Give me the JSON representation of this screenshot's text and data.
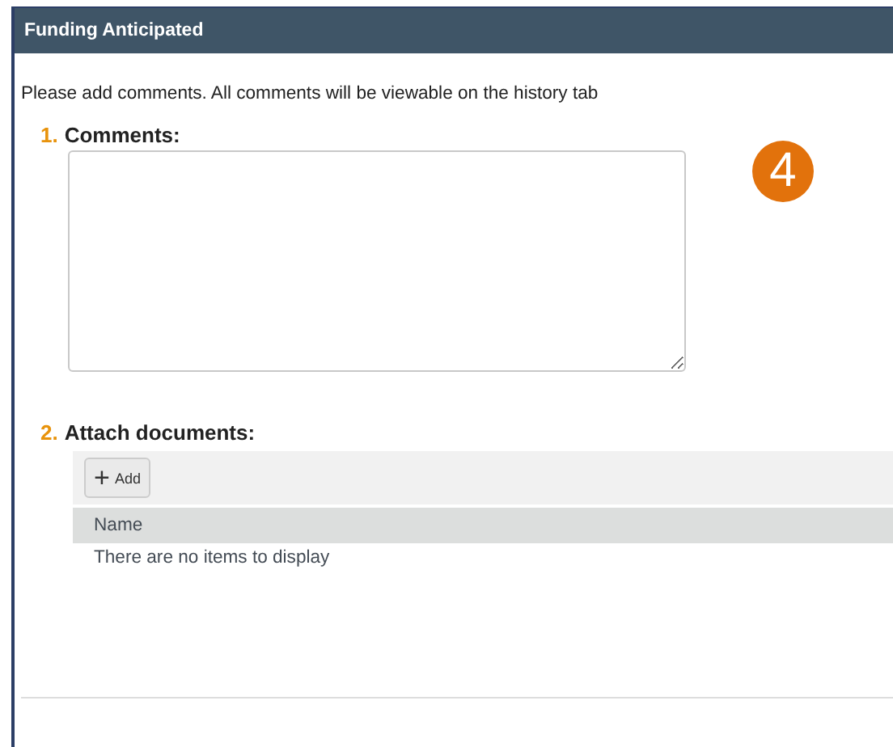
{
  "window": {
    "title": "Funding Anticipated"
  },
  "intro": "Please add comments. All comments will be viewable on the history tab",
  "step_badge": "4",
  "sections": [
    {
      "number": "1.",
      "title": "Comments:",
      "kind": "textarea"
    },
    {
      "number": "2.",
      "title": "Attach documents:",
      "kind": "documents"
    }
  ],
  "documents": {
    "add_icon": "+",
    "add_label": "Add",
    "columns": [
      "Name"
    ],
    "empty_text": "There are no items to display"
  }
}
